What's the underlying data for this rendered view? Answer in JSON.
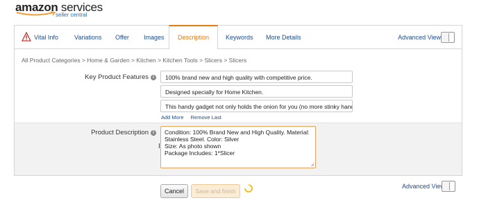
{
  "brand": {
    "name_bold": "amazon",
    "name_light": " services",
    "subtitle": "seller central",
    "smile_color": "#f19e38",
    "subtitle_color": "#1f6fb5"
  },
  "tabs": [
    {
      "label": "Vital Info",
      "icon": "warning-icon",
      "active": false
    },
    {
      "label": "Variations",
      "active": false
    },
    {
      "label": "Offer",
      "active": false
    },
    {
      "label": "Images",
      "active": false
    },
    {
      "label": "Description",
      "active": true
    },
    {
      "label": "Keywords",
      "active": false
    },
    {
      "label": "More Details",
      "active": false
    }
  ],
  "advanced_view_label": "Advanced View",
  "breadcrumb": "All Product Categories > Home & Garden > Kitchen > Kitchen Tools > Slicers > Slicers",
  "key_features": {
    "label": "Key Product Features",
    "values": [
      "100% brand new and high quality with competitive price.",
      "Designed specially for Home Kitchen.",
      "This handy gadget not only holds the onion for you (no more stinky hands)"
    ],
    "add_more": "Add More",
    "remove_last": "Remove Last"
  },
  "product_description": {
    "label": "Product Description",
    "lines": [
      "Condition: 100% Brand New and High Quality. Material:",
      "Stainless Steel. Color: Silver",
      "Size: As photo shown",
      "Package Includes: 1*Slicer"
    ]
  },
  "buttons": {
    "cancel": "Cancel",
    "save": "Save and finish"
  },
  "colors": {
    "accent": "#e47911",
    "link": "#1c4b8c"
  }
}
